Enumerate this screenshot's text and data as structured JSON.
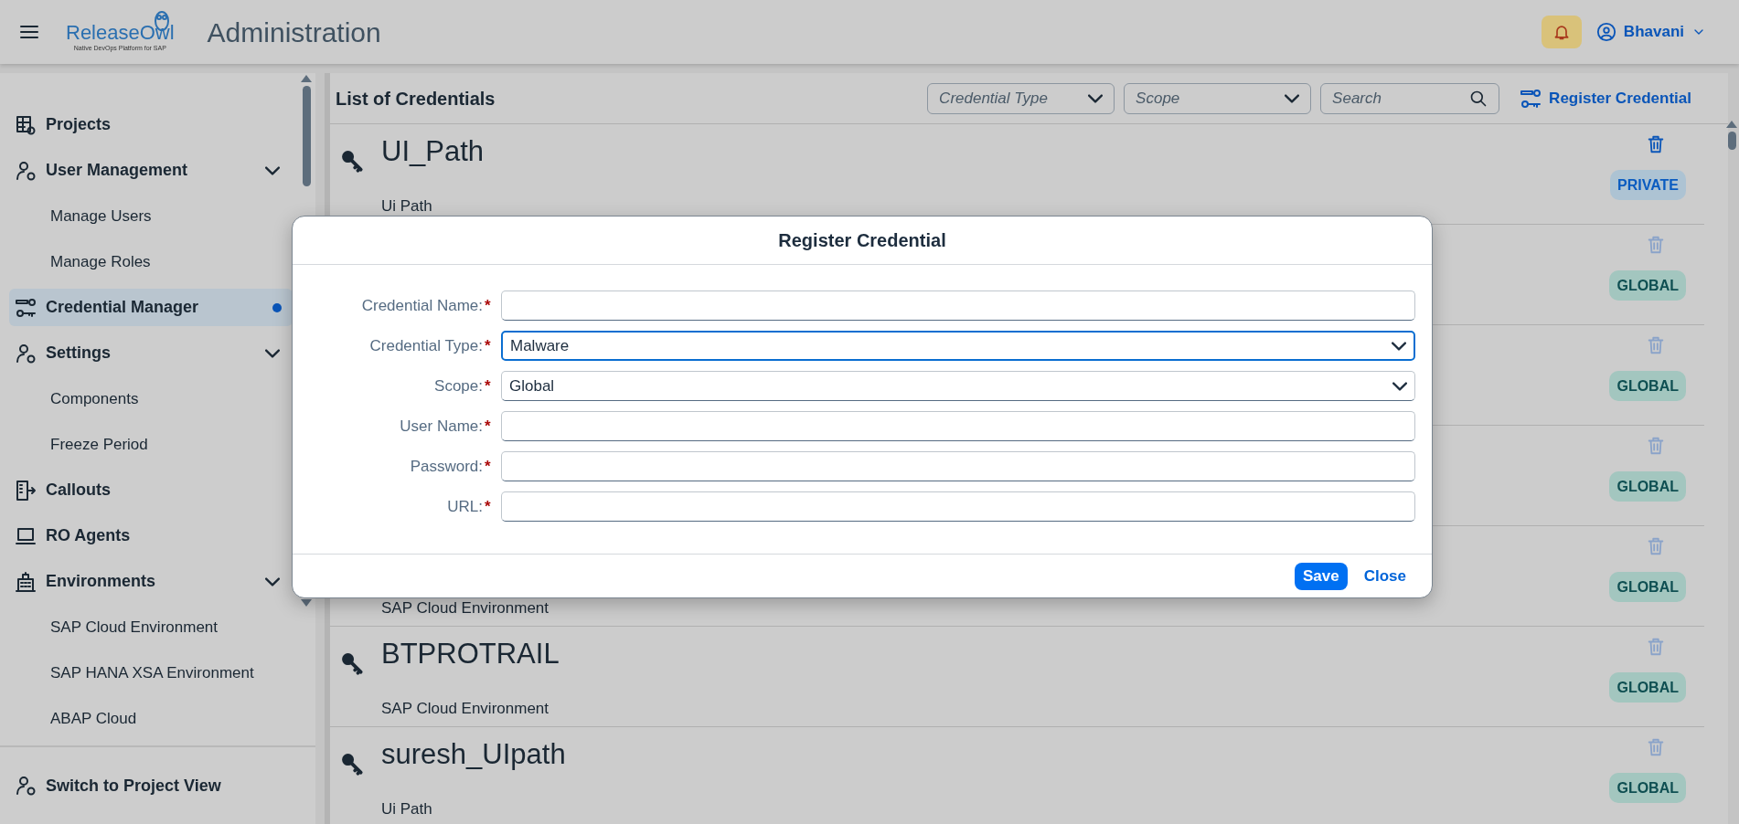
{
  "header": {
    "logo": {
      "name": "ReleaseOwl",
      "tagline": "Native DevOps Platform for SAP"
    },
    "title": "Administration",
    "user": "Bhavani"
  },
  "sidebar": {
    "items": [
      {
        "label": "Projects",
        "selected": false
      },
      {
        "label": "User Management",
        "selected": false,
        "expanded": true,
        "children": [
          {
            "label": "Manage Users",
            "selected": false
          },
          {
            "label": "Manage Roles",
            "selected": false
          }
        ]
      },
      {
        "label": "Credential Manager",
        "selected": true
      },
      {
        "label": "Settings",
        "selected": false,
        "expanded": true,
        "children": [
          {
            "label": "Components",
            "selected": false
          },
          {
            "label": "Freeze Period",
            "selected": false
          }
        ]
      },
      {
        "label": "Callouts",
        "selected": false
      },
      {
        "label": "RO Agents",
        "selected": false
      },
      {
        "label": "Environments",
        "selected": false,
        "expanded": true,
        "children": [
          {
            "label": "SAP Cloud Environment",
            "selected": false
          },
          {
            "label": "SAP HANA XSA Environment",
            "selected": false
          },
          {
            "label": "ABAP Cloud",
            "selected": false
          }
        ]
      }
    ],
    "footer": "Switch to Project View"
  },
  "list": {
    "title": "List of Credentials",
    "filters": [
      {
        "placeholder": "Credential Type",
        "kind": "select"
      },
      {
        "placeholder": "Scope",
        "kind": "select"
      },
      {
        "placeholder": "Search",
        "kind": "search"
      }
    ],
    "register_button": "Register Credential",
    "rows": [
      {
        "name": "UI_Path",
        "type": "Ui Path",
        "scope": "PRIVATE",
        "kind": "private",
        "delete_disabled": false
      },
      {
        "scope": "GLOBAL",
        "kind": "global",
        "delete_disabled": true
      },
      {
        "scope": "GLOBAL",
        "kind": "global",
        "delete_disabled": true
      },
      {
        "scope": "GLOBAL",
        "kind": "global",
        "delete_disabled": true
      },
      {
        "type": "SAP Cloud Environment",
        "scope": "GLOBAL",
        "kind": "global",
        "delete_disabled": true
      },
      {
        "name": "BTPROTRAIL",
        "type": "SAP Cloud Environment",
        "scope": "GLOBAL",
        "kind": "global",
        "delete_disabled": true
      },
      {
        "name": "suresh_UIpath",
        "type": "Ui Path",
        "scope": "GLOBAL",
        "kind": "global",
        "delete_disabled": true
      }
    ]
  },
  "dialog": {
    "title": "Register Credential",
    "required_marker": "*",
    "fields": [
      {
        "label": "Credential Name:",
        "required": true,
        "kind": "text",
        "focused": false
      },
      {
        "label": "Credential Type:",
        "required": true,
        "kind": "select",
        "value": "Malware",
        "focused": true
      },
      {
        "label": "Scope:",
        "required": true,
        "kind": "select",
        "value": "Global",
        "focused": false
      },
      {
        "label": "User Name:",
        "required": true,
        "kind": "text",
        "focused": false
      },
      {
        "label": "Password:",
        "required": true,
        "kind": "text",
        "focused": false
      },
      {
        "label": "URL:",
        "required": true,
        "kind": "text",
        "focused": false
      }
    ],
    "buttons": [
      {
        "label": "Save",
        "kind": "primary"
      },
      {
        "label": "Close",
        "kind": "link"
      }
    ]
  }
}
